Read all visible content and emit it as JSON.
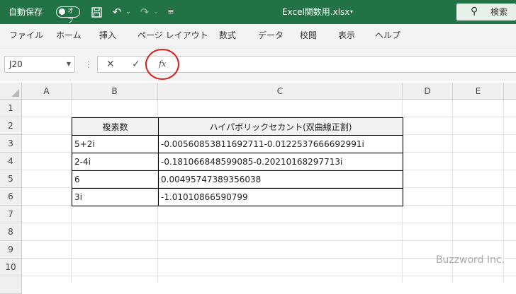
{
  "titlebar": {
    "autosave_label": "自動保存",
    "autosave_state": "オフ",
    "filename": "Excel関数用.xlsx",
    "search_label": "検索",
    "icons": [
      "save-icon",
      "undo-icon",
      "redo-icon",
      "customize-qat-icon",
      "search-icon"
    ]
  },
  "ribbon": {
    "tabs": [
      "ファイル",
      "ホーム",
      "挿入",
      "ページ レイアウト",
      "数式",
      "データ",
      "校閲",
      "表示",
      "ヘルプ"
    ]
  },
  "formula_bar": {
    "name_box": "J20",
    "cancel_symbol": "✕",
    "enter_symbol": "✓",
    "fx_label": "fx",
    "content": ""
  },
  "sheet": {
    "columns": [
      "A",
      "B",
      "C",
      "D",
      "E"
    ],
    "rows": [
      "1",
      "2",
      "3",
      "4",
      "5",
      "6",
      "7",
      "8",
      "9",
      "10"
    ],
    "table": {
      "header": {
        "b": "複素数",
        "c": "ハイパボリックセカント(双曲線正割)"
      },
      "rows": [
        {
          "b": "5+2i",
          "c": "-0.00560853811692711-0.0122537666692991i"
        },
        {
          "b": "2-4i",
          "c": "-0.181066848599085-0.20210168297713i"
        },
        {
          "b": "6",
          "c": "0.00495747389356038"
        },
        {
          "b": "3i",
          "c": "-1.01010866590799"
        }
      ]
    }
  },
  "watermark": "Buzzword Inc.",
  "colors": {
    "titlebar": "#217346",
    "highlight_circle": "#d81e1e"
  }
}
